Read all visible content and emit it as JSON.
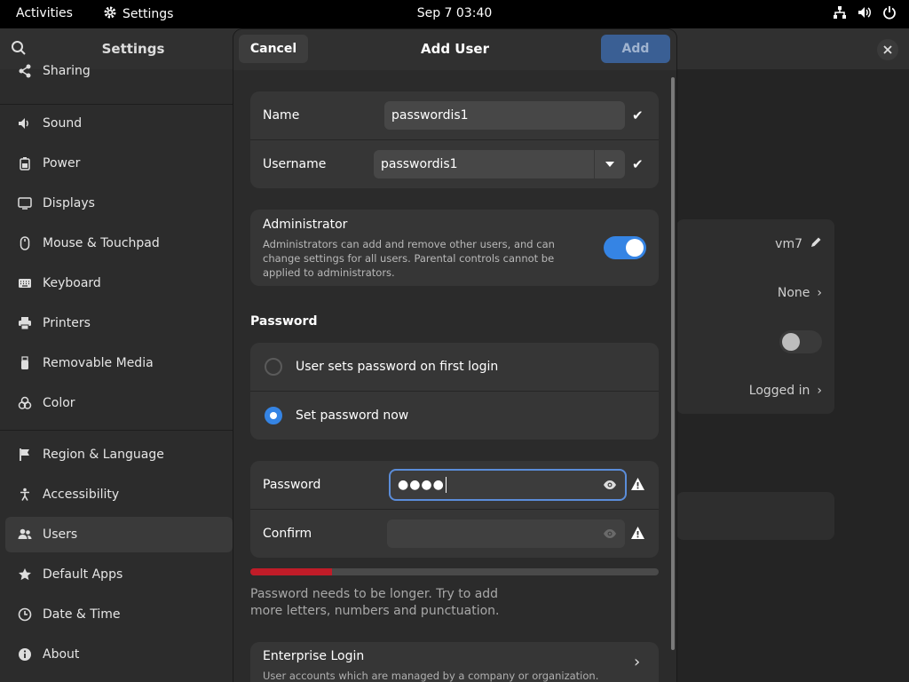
{
  "topbar": {
    "activities": "Activities",
    "app_name": "Settings",
    "clock": "Sep 7  03:40",
    "tray_icons": [
      "network-icon",
      "volume-icon",
      "power-icon"
    ]
  },
  "sidebar": {
    "title": "Settings",
    "items": [
      {
        "label": "Sharing",
        "icon": "share-icon"
      },
      {
        "label": "Sound",
        "icon": "speaker-icon"
      },
      {
        "label": "Power",
        "icon": "battery-icon"
      },
      {
        "label": "Displays",
        "icon": "display-icon"
      },
      {
        "label": "Mouse & Touchpad",
        "icon": "mouse-icon"
      },
      {
        "label": "Keyboard",
        "icon": "keyboard-icon"
      },
      {
        "label": "Printers",
        "icon": "printer-icon"
      },
      {
        "label": "Removable Media",
        "icon": "usb-icon"
      },
      {
        "label": "Color",
        "icon": "color-icon"
      },
      {
        "label": "Region & Language",
        "icon": "flag-icon"
      },
      {
        "label": "Accessibility",
        "icon": "accessibility-icon"
      },
      {
        "label": "Users",
        "icon": "users-icon",
        "active": true
      },
      {
        "label": "Default Apps",
        "icon": "star-icon"
      },
      {
        "label": "Date & Time",
        "icon": "clock-icon"
      },
      {
        "label": "About",
        "icon": "info-icon"
      }
    ]
  },
  "background_panel": {
    "rows": [
      {
        "value": "vm7"
      },
      {
        "value": "None"
      },
      {
        "value": ""
      },
      {
        "value": "Logged in"
      }
    ]
  },
  "dialog": {
    "cancel_label": "Cancel",
    "title": "Add User",
    "add_label": "Add",
    "name_label": "Name",
    "name_value": "passwordis1",
    "username_label": "Username",
    "username_value": "passwordis1",
    "admin_title": "Administrator",
    "admin_desc": "Administrators can add and remove other users, and can change settings for all users. Parental controls cannot be applied to administrators.",
    "admin_enabled": true,
    "password_section": "Password",
    "radio_first_login": "User sets password on first login",
    "radio_set_now": "Set password now",
    "password_label": "Password",
    "password_value": "●●●●",
    "confirm_label": "Confirm",
    "confirm_value": "",
    "strength_level": 0.2,
    "strength_color": "#c01c28",
    "hint": "Password needs to be longer. Try to add more letters, numbers and punctuation.",
    "enterprise_title": "Enterprise Login",
    "enterprise_desc": "User accounts which are managed by a company or organization."
  },
  "colors": {
    "accent": "#3584e4",
    "add_button": "#3a5f94",
    "danger": "#c01c28"
  }
}
